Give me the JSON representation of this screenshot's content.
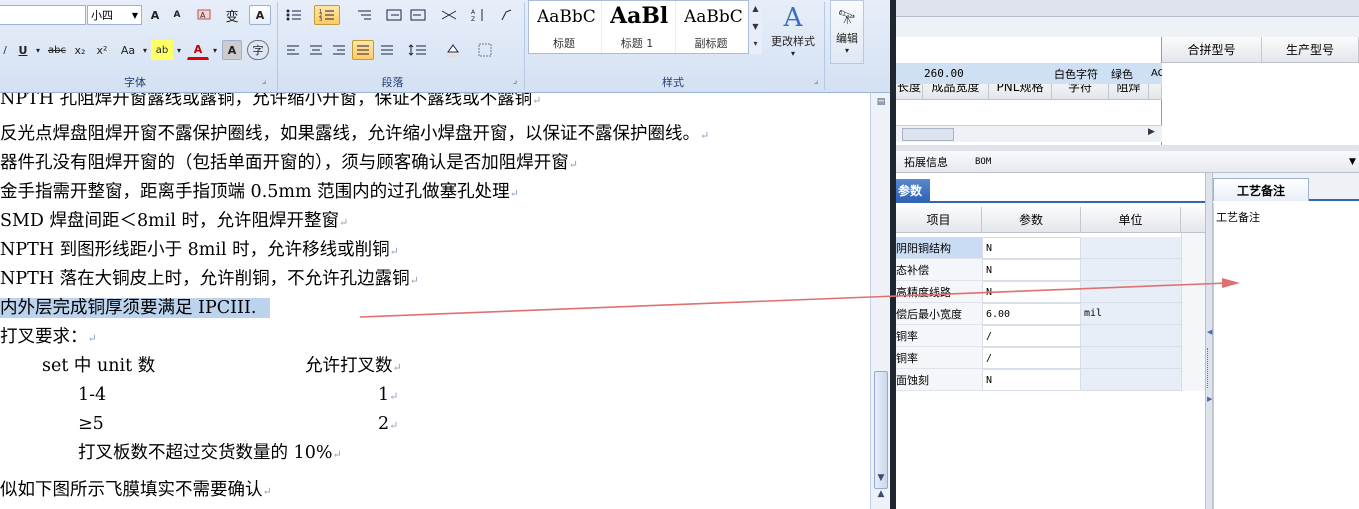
{
  "ribbon": {
    "font_size_value": "小四",
    "groups": {
      "font": "字体",
      "paragraph": "段落",
      "styles": "样式"
    },
    "styles": [
      {
        "sample": "AaBbC",
        "name": "标题"
      },
      {
        "sample": "AaBl",
        "name": "标题 1"
      },
      {
        "sample": "AaBbC",
        "name": "副标题"
      }
    ],
    "change_styles_label": "更改样式",
    "edit_label": "编辑",
    "font_buttons": {
      "grow": "A",
      "shrink": "A",
      "underline": "U",
      "strike": "abc",
      "sub": "x₂",
      "sup": "x²",
      "case": "Aa",
      "highlight": "ab",
      "color": "A",
      "border_char": "A",
      "enclose": "字",
      "phonetic": "变"
    }
  },
  "document": {
    "lines": [
      "NPTH 孔阻焊开窗露线或露铜，允许缩小开窗，保证不露线或不露铜",
      "反光点焊盘阻焊开窗不露保护圈线，如果露线，允许缩小焊盘开窗，以保证不露保护圈线。",
      "器件孔没有阻焊开窗的（包括单面开窗的），须与顾客确认是否加阻焊开窗",
      "金手指需开整窗，距离手指顶端 0.5mm 范围内的过孔做塞孔处理",
      "SMD 焊盘间距＜8mil 时，允许阻焊开整窗",
      "NPTH 到图形线距小于 8mil 时，允许移线或削铜",
      "NPTH 落在大铜皮上时，允许削铜，不允许孔边露铜",
      "内外层完成铜厚须要满足 IPCIII.",
      "打叉要求："
    ],
    "table_header": {
      "col1": "set 中 unit 数",
      "col2": "允许打叉数"
    },
    "table_rows": [
      {
        "col1": "1-4",
        "col2": "1"
      },
      {
        "col1": "≥5",
        "col2": "2"
      }
    ],
    "note": "打叉板数不超过交货数量的 10%",
    "last_line": "似如下图所示飞膜填实不需要确认"
  },
  "grid": {
    "headers": [
      "长度",
      "成品宽度",
      "PNL规格",
      "字符",
      "阻焊"
    ],
    "row": {
      "width": "260.00",
      "silk": "白色字符",
      "mask": "绿色",
      "extra": "AC"
    },
    "side_headers": [
      "合拼型号",
      "生产型号"
    ]
  },
  "tabs": {
    "extend": "拓展信息",
    "bom": "BOM"
  },
  "params": {
    "title": "参数",
    "headers": {
      "item": "项目",
      "param": "参数",
      "unit": "单位"
    },
    "rows": [
      {
        "label": "阴阳铜结构",
        "value": "N",
        "unit": ""
      },
      {
        "label": "态补偿",
        "value": "N",
        "unit": ""
      },
      {
        "label": "高精度线路",
        "value": "N",
        "unit": ""
      },
      {
        "label": "偿后最小宽度",
        "value": "6.00",
        "unit": "mil"
      },
      {
        "label": "铜率",
        "value": "/",
        "unit": ""
      },
      {
        "label": "铜率",
        "value": "/",
        "unit": ""
      },
      {
        "label": "面蚀刻",
        "value": "N",
        "unit": ""
      }
    ]
  },
  "notes": {
    "tab": "工艺备注",
    "label": "工艺备注"
  },
  "colors": {
    "accent_arrow": "#e07070",
    "selection": "#bcd3ee",
    "ribbon_blue": "#d4e1f3"
  }
}
